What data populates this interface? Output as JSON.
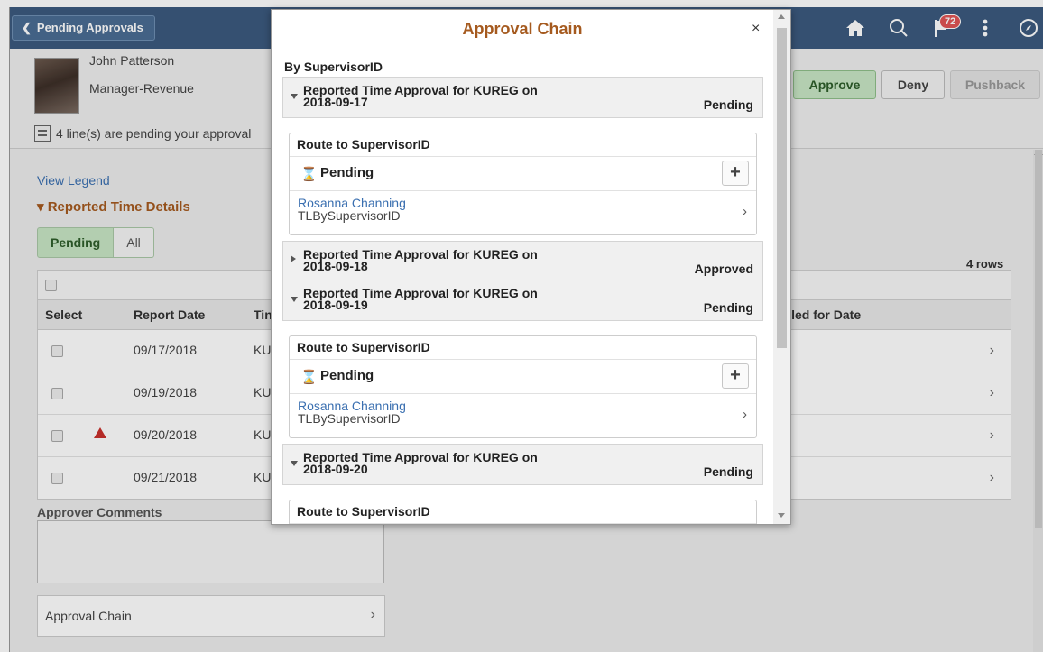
{
  "banner": {
    "back_label": "Pending Approvals",
    "notification_count": "72",
    "icons": [
      "home-icon",
      "search-icon",
      "notification-flag-icon",
      "actions-menu-icon",
      "navbar-compass-icon"
    ]
  },
  "employee": {
    "name": "John Patterson",
    "title": "Manager-Revenue",
    "pending_message": "4 line(s) are pending your approval"
  },
  "actions": {
    "approve": "Approve",
    "deny": "Deny",
    "pushback": "Pushback"
  },
  "main": {
    "view_legend": "View Legend",
    "section_title": "Reported Time Details",
    "filters": [
      "Pending",
      "All"
    ],
    "rows_count": "4 rows",
    "columns": {
      "select": "Select",
      "report_date": "Report Date",
      "time": "Tin",
      "scheduled": "duled for Date"
    },
    "rows": [
      {
        "date": "09/17/2018",
        "code": "KU",
        "warning": false
      },
      {
        "date": "09/19/2018",
        "code": "KU",
        "warning": false
      },
      {
        "date": "09/20/2018",
        "code": "KU",
        "warning": true
      },
      {
        "date": "09/21/2018",
        "code": "KU",
        "warning": false
      }
    ],
    "approver_comments_label": "Approver Comments",
    "approval_chain_label": "Approval Chain"
  },
  "modal": {
    "title": "Approval Chain",
    "close": "×",
    "by_label": "By SupervisorID",
    "approvals": [
      {
        "line1": "Reported Time Approval for KUREG on",
        "line2": "2018-09-17",
        "status": "Pending",
        "expanded": true,
        "route": {
          "title": "Route to SupervisorID",
          "step_status": "Pending",
          "approver": "Rosanna Channing",
          "role": "TLBySupervisorID"
        }
      },
      {
        "line1": "Reported Time Approval for KUREG on",
        "line2": "2018-09-18",
        "status": "Approved",
        "expanded": false
      },
      {
        "line1": "Reported Time Approval for KUREG on",
        "line2": "2018-09-19",
        "status": "Pending",
        "expanded": true,
        "route": {
          "title": "Route to SupervisorID",
          "step_status": "Pending",
          "approver": "Rosanna Channing",
          "role": "TLBySupervisorID"
        }
      },
      {
        "line1": "Reported Time Approval for KUREG on",
        "line2": "2018-09-20",
        "status": "Pending",
        "expanded": true,
        "route": {
          "title": "Route to SupervisorID"
        }
      }
    ]
  },
  "colors": {
    "banner": "#3b5a7e",
    "title_orange": "#a55a1f",
    "approve_green": "#c8e6c4",
    "link_blue": "#3a6fb0",
    "warning_red": "#c9302c"
  }
}
